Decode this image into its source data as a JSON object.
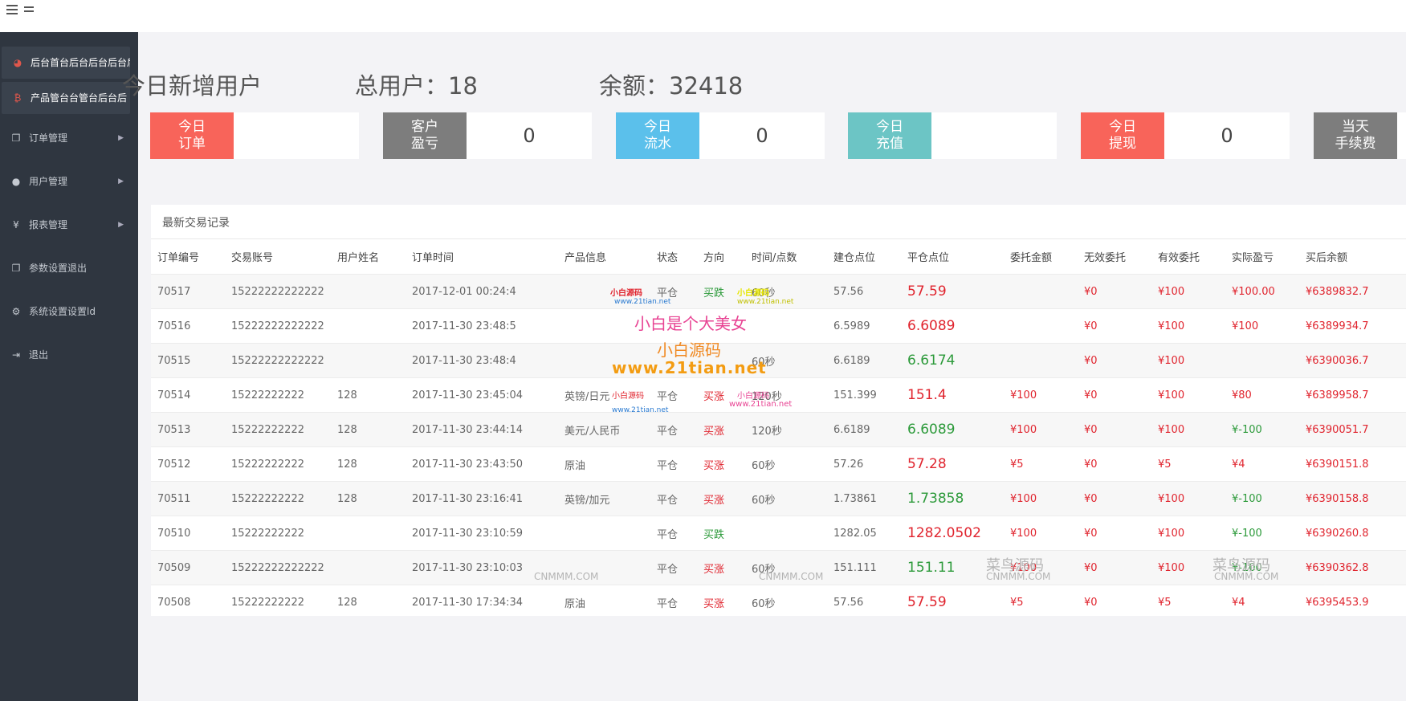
{
  "header": {
    "menu_icon": "hamburger-icon"
  },
  "sidebar": {
    "items": [
      {
        "label": "后台首台后台后台后台后",
        "icon": "dashboard-icon",
        "glyph": "◕",
        "arrow": false,
        "active": true
      },
      {
        "label": "产品管台台管台后台后",
        "icon": "bitcoin-icon",
        "glyph": "₿",
        "arrow": false,
        "active": true
      },
      {
        "label": "订单管理",
        "icon": "copy-icon",
        "glyph": "❐",
        "arrow": true,
        "active": false
      },
      {
        "label": "用户管理",
        "icon": "user-icon",
        "glyph": "●",
        "arrow": true,
        "active": false
      },
      {
        "label": "报表管理",
        "icon": "yen-icon",
        "glyph": "¥",
        "arrow": true,
        "active": false
      },
      {
        "label": "参数设置退出",
        "icon": "copy-icon",
        "glyph": "❐",
        "arrow": false,
        "active": false
      },
      {
        "label": "系统设置设置ld",
        "icon": "gears-icon",
        "glyph": "⚙",
        "arrow": false,
        "active": false
      },
      {
        "label": "退出",
        "icon": "sign-out-icon",
        "glyph": "⇥",
        "arrow": false,
        "active": false
      }
    ]
  },
  "stats": {
    "today_new_users": "今日新增用户",
    "total_users": "总用户：18",
    "total_balance": "余额：32418"
  },
  "cards": [
    {
      "label": "今日\n订单",
      "value": "",
      "color": "#f8645a"
    },
    {
      "label": "客户\n盈亏",
      "value": "0",
      "color": "#7d7d7d"
    },
    {
      "label": "今日\n流水",
      "value": "0",
      "color": "#5bc0eb"
    },
    {
      "label": "今日\n充值",
      "value": "",
      "color": "#6cc5c5"
    },
    {
      "label": "今日\n提现",
      "value": "0",
      "color": "#f8645a"
    },
    {
      "label": "当天\n手续费",
      "value": "",
      "color": "#7d7d7d"
    }
  ],
  "table": {
    "title": "最新交易记录",
    "columns": [
      "订单编号",
      "交易账号",
      "用户姓名",
      "订单时间",
      "产品信息",
      "状态",
      "方向",
      "时间/点数",
      "建仓点位",
      "平仓点位",
      "委托金额",
      "无效委托",
      "有效委托",
      "实际盈亏",
      "买后余额"
    ],
    "rows": [
      {
        "id": "70517",
        "account": "15222222222222",
        "name": "",
        "time": "2017-12-01 00:24:4",
        "product": "",
        "status": "平仓",
        "dir": "买跌",
        "dir_color": "green",
        "duration": "60秒",
        "open": "57.56",
        "close": "57.59",
        "close_color": "red",
        "amount": "",
        "invalid": "¥0",
        "valid": "¥100",
        "pl": "¥100.00",
        "pl_color": "red",
        "balance": "¥6389832.7"
      },
      {
        "id": "70516",
        "account": "15222222222222",
        "name": "",
        "time": "2017-11-30 23:48:5",
        "product": "",
        "status": "",
        "dir": "",
        "dir_color": "red",
        "duration": "",
        "open": "6.5989",
        "close": "6.6089",
        "close_color": "red",
        "amount": "",
        "invalid": "¥0",
        "valid": "¥100",
        "pl": "¥100",
        "pl_color": "red",
        "balance": "¥6389934.7"
      },
      {
        "id": "70515",
        "account": "15222222222222",
        "name": "",
        "time": "2017-11-30 23:48:4",
        "product": "",
        "status": "",
        "dir": "",
        "dir_color": "red",
        "duration": "60秒",
        "open": "6.6189",
        "close": "6.6174",
        "close_color": "green",
        "amount": "",
        "invalid": "¥0",
        "valid": "¥100",
        "pl": "",
        "pl_color": "red",
        "balance": "¥6390036.7"
      },
      {
        "id": "70514",
        "account": "15222222222",
        "name": "128",
        "time": "2017-11-30 23:45:04",
        "product": "英镑/日元",
        "status": "平仓",
        "dir": "买涨",
        "dir_color": "red",
        "duration": "120秒",
        "open": "151.399",
        "close": "151.4",
        "close_color": "red",
        "amount": "¥100",
        "invalid": "¥0",
        "valid": "¥100",
        "pl": "¥80",
        "pl_color": "red",
        "balance": "¥6389958.7"
      },
      {
        "id": "70513",
        "account": "15222222222",
        "name": "128",
        "time": "2017-11-30 23:44:14",
        "product": "美元/人民币",
        "status": "平仓",
        "dir": "买涨",
        "dir_color": "red",
        "duration": "120秒",
        "open": "6.6189",
        "close": "6.6089",
        "close_color": "green",
        "amount": "¥100",
        "invalid": "¥0",
        "valid": "¥100",
        "pl": "¥-100",
        "pl_color": "green",
        "balance": "¥6390051.7"
      },
      {
        "id": "70512",
        "account": "15222222222",
        "name": "128",
        "time": "2017-11-30 23:43:50",
        "product": "原油",
        "status": "平仓",
        "dir": "买涨",
        "dir_color": "red",
        "duration": "60秒",
        "open": "57.26",
        "close": "57.28",
        "close_color": "red",
        "amount": "¥5",
        "invalid": "¥0",
        "valid": "¥5",
        "pl": "¥4",
        "pl_color": "red",
        "balance": "¥6390151.8"
      },
      {
        "id": "70511",
        "account": "15222222222",
        "name": "128",
        "time": "2017-11-30 23:16:41",
        "product": "英镑/加元",
        "status": "平仓",
        "dir": "买涨",
        "dir_color": "red",
        "duration": "60秒",
        "open": "1.73861",
        "close": "1.73858",
        "close_color": "green",
        "amount": "¥100",
        "invalid": "¥0",
        "valid": "¥100",
        "pl": "¥-100",
        "pl_color": "green",
        "balance": "¥6390158.8"
      },
      {
        "id": "70510",
        "account": "15222222222",
        "name": "",
        "time": "2017-11-30 23:10:59",
        "product": "",
        "status": "平仓",
        "dir": "买跌",
        "dir_color": "green",
        "duration": "",
        "open": "1282.05",
        "close": "1282.0502",
        "close_color": "red",
        "amount": "¥100",
        "invalid": "¥0",
        "valid": "¥100",
        "pl": "¥-100",
        "pl_color": "green",
        "balance": "¥6390260.8"
      },
      {
        "id": "70509",
        "account": "15222222222222",
        "name": "",
        "time": "2017-11-30 23:10:03",
        "product": "",
        "status": "平仓",
        "dir": "买涨",
        "dir_color": "red",
        "duration": "60秒",
        "open": "151.111",
        "close": "151.11",
        "close_color": "green",
        "amount": "¥100",
        "invalid": "¥0",
        "valid": "¥100",
        "pl": "¥-100",
        "pl_color": "green",
        "balance": "¥6390362.8"
      },
      {
        "id": "70508",
        "account": "15222222222",
        "name": "128",
        "time": "2017-11-30 17:34:34",
        "product": "原油",
        "status": "平仓",
        "dir": "买涨",
        "dir_color": "red",
        "duration": "60秒",
        "open": "57.56",
        "close": "57.59",
        "close_color": "red",
        "amount": "¥5",
        "invalid": "¥0",
        "valid": "¥5",
        "pl": "¥4",
        "pl_color": "red",
        "balance": "¥6395453.9"
      }
    ]
  },
  "watermarks": {
    "xiaobai_small": "小白源码",
    "xiaobai_url": "www.21tian.net",
    "xiaobai_big": "小白是个大美女",
    "xiaobai_code": "小白源码",
    "xiaobai_url_big": "www.21tian.net",
    "cainiao": "菜鸟源码",
    "cnmmm": "CNMMM.COM"
  }
}
